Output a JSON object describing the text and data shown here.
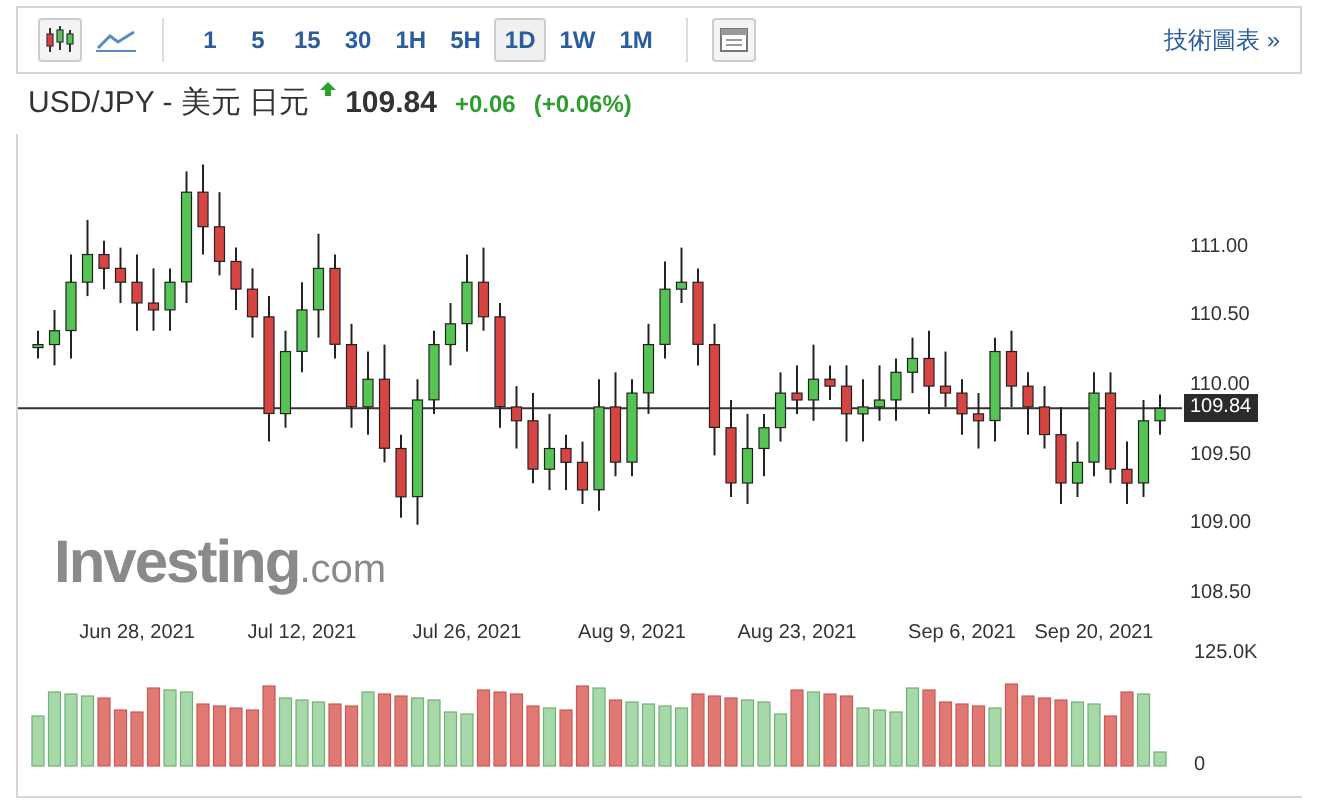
{
  "toolbar": {
    "chart_types": [
      {
        "kind": "candlestick",
        "selected": true
      },
      {
        "kind": "line",
        "selected": false
      }
    ],
    "intervals": [
      {
        "label": "1",
        "selected": false
      },
      {
        "label": "5",
        "selected": false
      },
      {
        "label": "15",
        "selected": false
      },
      {
        "label": "30",
        "selected": false
      },
      {
        "label": "1H",
        "selected": false
      },
      {
        "label": "5H",
        "selected": false
      },
      {
        "label": "1D",
        "selected": true
      },
      {
        "label": "1W",
        "selected": false
      },
      {
        "label": "1M",
        "selected": false
      }
    ],
    "technical_link": "技術圖表 »"
  },
  "quote": {
    "symbol": "USD/JPY - 美元 日元",
    "price": "109.84",
    "change": "+0.06",
    "change_percent": "(+0.06%)"
  },
  "chart": {
    "chart_data": {
      "type": "candlestick",
      "categories": [
        null,
        null,
        null,
        null,
        null,
        null,
        "Jun 28, 2021",
        null,
        null,
        null,
        null,
        null,
        null,
        null,
        null,
        null,
        "Jul 12, 2021",
        null,
        null,
        null,
        null,
        null,
        null,
        null,
        null,
        null,
        "Jul 26, 2021",
        null,
        null,
        null,
        null,
        null,
        null,
        null,
        null,
        null,
        "Aug 9, 2021",
        null,
        null,
        null,
        null,
        null,
        null,
        null,
        null,
        null,
        "Aug 23, 2021",
        null,
        null,
        null,
        null,
        null,
        null,
        null,
        null,
        null,
        "Sep 6, 2021",
        null,
        null,
        null,
        null,
        null,
        null,
        null,
        "Sep 20, 2021",
        null,
        null,
        null,
        null
      ],
      "ohlc": [
        [
          110.3,
          110.4,
          110.2,
          110.3
        ],
        [
          110.3,
          110.55,
          110.15,
          110.4
        ],
        [
          110.4,
          110.95,
          110.2,
          110.75
        ],
        [
          110.75,
          111.2,
          110.65,
          110.95
        ],
        [
          110.95,
          111.05,
          110.7,
          110.85
        ],
        [
          110.85,
          111.0,
          110.6,
          110.75
        ],
        [
          110.75,
          110.95,
          110.4,
          110.6
        ],
        [
          110.6,
          110.85,
          110.4,
          110.55
        ],
        [
          110.55,
          110.85,
          110.4,
          110.75
        ],
        [
          110.75,
          111.55,
          110.6,
          111.4
        ],
        [
          111.4,
          111.6,
          110.95,
          111.15
        ],
        [
          111.15,
          111.4,
          110.8,
          110.9
        ],
        [
          110.9,
          111.0,
          110.55,
          110.7
        ],
        [
          110.7,
          110.85,
          110.35,
          110.5
        ],
        [
          110.5,
          110.65,
          109.6,
          109.8
        ],
        [
          109.8,
          110.4,
          109.7,
          110.25
        ],
        [
          110.25,
          110.75,
          110.1,
          110.55
        ],
        [
          110.55,
          111.1,
          110.35,
          110.85
        ],
        [
          110.85,
          110.95,
          110.2,
          110.3
        ],
        [
          110.3,
          110.45,
          109.7,
          109.85
        ],
        [
          109.85,
          110.25,
          109.65,
          110.05
        ],
        [
          110.05,
          110.3,
          109.45,
          109.55
        ],
        [
          109.55,
          109.65,
          109.05,
          109.2
        ],
        [
          109.2,
          110.05,
          109.0,
          109.9
        ],
        [
          109.9,
          110.4,
          109.8,
          110.3
        ],
        [
          110.3,
          110.6,
          110.15,
          110.45
        ],
        [
          110.45,
          110.95,
          110.25,
          110.75
        ],
        [
          110.75,
          111.0,
          110.4,
          110.5
        ],
        [
          110.5,
          110.6,
          109.7,
          109.85
        ],
        [
          109.85,
          110.0,
          109.55,
          109.75
        ],
        [
          109.75,
          109.95,
          109.3,
          109.4
        ],
        [
          109.4,
          109.8,
          109.25,
          109.55
        ],
        [
          109.55,
          109.65,
          109.25,
          109.45
        ],
        [
          109.45,
          109.6,
          109.15,
          109.25
        ],
        [
          109.25,
          110.05,
          109.1,
          109.85
        ],
        [
          109.85,
          110.1,
          109.35,
          109.45
        ],
        [
          109.45,
          110.05,
          109.35,
          109.95
        ],
        [
          109.95,
          110.45,
          109.8,
          110.3
        ],
        [
          110.3,
          110.9,
          110.2,
          110.7
        ],
        [
          110.7,
          111.0,
          110.6,
          110.75
        ],
        [
          110.75,
          110.85,
          110.15,
          110.3
        ],
        [
          110.3,
          110.45,
          109.5,
          109.7
        ],
        [
          109.7,
          109.9,
          109.2,
          109.3
        ],
        [
          109.3,
          109.8,
          109.15,
          109.55
        ],
        [
          109.55,
          109.8,
          109.35,
          109.7
        ],
        [
          109.7,
          110.1,
          109.6,
          109.95
        ],
        [
          109.95,
          110.15,
          109.8,
          109.9
        ],
        [
          109.9,
          110.3,
          109.75,
          110.05
        ],
        [
          110.05,
          110.15,
          109.9,
          110.0
        ],
        [
          110.0,
          110.15,
          109.6,
          109.8
        ],
        [
          109.8,
          110.05,
          109.6,
          109.85
        ],
        [
          109.85,
          110.15,
          109.75,
          109.9
        ],
        [
          109.9,
          110.2,
          109.75,
          110.1
        ],
        [
          110.1,
          110.35,
          109.95,
          110.2
        ],
        [
          110.2,
          110.4,
          109.8,
          110.0
        ],
        [
          110.0,
          110.25,
          109.85,
          109.95
        ],
        [
          109.95,
          110.05,
          109.65,
          109.8
        ],
        [
          109.8,
          109.95,
          109.55,
          109.75
        ],
        [
          109.75,
          110.35,
          109.6,
          110.25
        ],
        [
          110.25,
          110.4,
          109.85,
          110.0
        ],
        [
          110.0,
          110.1,
          109.65,
          109.85
        ],
        [
          109.85,
          110.0,
          109.55,
          109.65
        ],
        [
          109.65,
          109.85,
          109.15,
          109.3
        ],
        [
          109.3,
          109.6,
          109.2,
          109.45
        ],
        [
          109.45,
          110.1,
          109.35,
          109.95
        ],
        [
          109.95,
          110.1,
          109.3,
          109.4
        ],
        [
          109.4,
          109.6,
          109.15,
          109.3
        ],
        [
          109.3,
          109.9,
          109.2,
          109.75
        ],
        [
          109.75,
          109.94,
          109.65,
          109.84
        ]
      ],
      "ylim": [
        108.5,
        111.82
      ],
      "ref_lines": [
        {
          "axis": "y",
          "value": 109.84,
          "label": "109.84"
        }
      ],
      "yticks": [
        {
          "value": 111,
          "label": "111.00"
        },
        {
          "value": 110.5,
          "label": "110.50"
        },
        {
          "value": 110,
          "label": "110.00"
        },
        {
          "value": 109.5,
          "label": "109.50"
        },
        {
          "value": 109,
          "label": "109.00"
        },
        {
          "value": 108.5,
          "label": "108.50"
        }
      ]
    },
    "volume_axis": [
      "125.0K",
      "0"
    ],
    "logo": {
      "name": "Investing",
      "suffix": ".com"
    }
  }
}
